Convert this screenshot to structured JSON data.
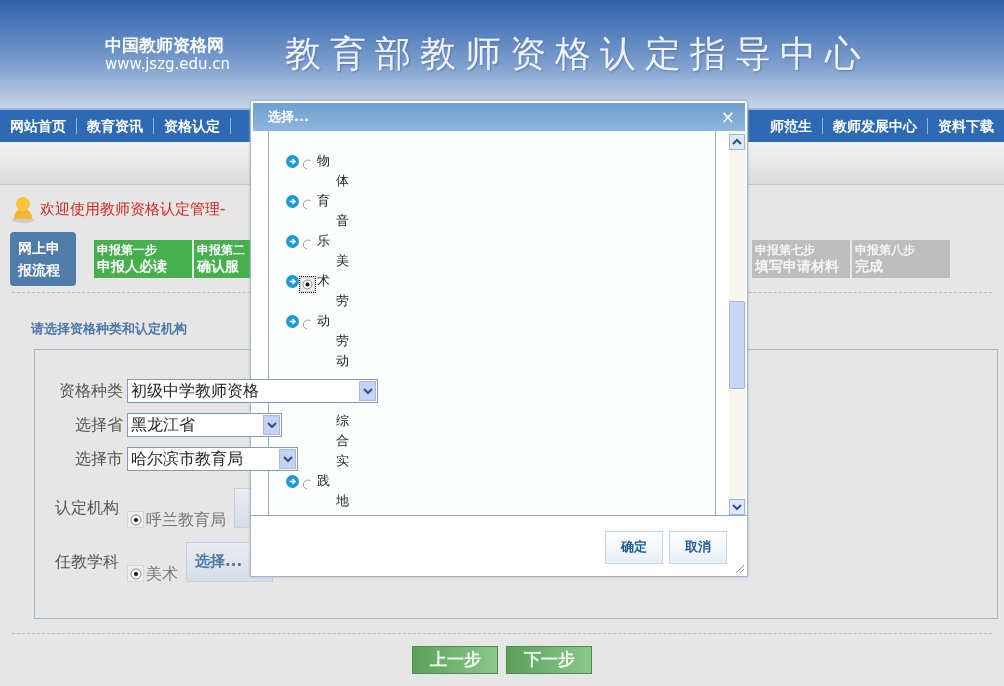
{
  "header": {
    "site_name": "中国教师资格网",
    "site_url": "www.jszg.edu.cn",
    "title": "教育部教师资格认定指导中心"
  },
  "nav": {
    "left": [
      "网站首页",
      "教育资讯",
      "资格认定"
    ],
    "right": [
      "师范生",
      "教师发展中心",
      "资料下载"
    ]
  },
  "welcome": "欢迎使用教师资格认定管理-",
  "process": {
    "label": "网上申报流程",
    "steps_left": [
      {
        "line1": "申报第一步",
        "line2": "申报人必读",
        "done": true
      },
      {
        "line1": "申报第二",
        "line2": "确认服",
        "done": true
      }
    ],
    "steps_right": [
      {
        "line1": "申报第七步",
        "line2": "填写申请材料",
        "done": false
      },
      {
        "line1": "申报第八步",
        "line2": "完成",
        "done": false
      }
    ]
  },
  "form": {
    "section_title": "请选择资格种类和认定机构",
    "selects": [
      {
        "label": "资格种类",
        "value": "初级中学教师资格"
      },
      {
        "label": "选择省",
        "value": "黑龙江省"
      },
      {
        "label": "选择市",
        "value": "哈尔滨市教育局"
      }
    ],
    "authority": {
      "label": "认定机构",
      "option": {
        "text": "呼兰教育局",
        "selected": true
      }
    },
    "subject": {
      "label": "任教学科",
      "option": {
        "text": "美术",
        "selected": true
      },
      "button": "选择..."
    }
  },
  "footer_buttons": [
    "上一步",
    "下一步"
  ],
  "dialog": {
    "title": "选择...",
    "close": "×",
    "lines": [
      {
        "kind": "option",
        "text": "物",
        "selected": false
      },
      {
        "kind": "text",
        "text": "体"
      },
      {
        "kind": "option",
        "text": "育",
        "selected": false
      },
      {
        "kind": "text",
        "text": "音"
      },
      {
        "kind": "option",
        "text": "乐",
        "selected": false
      },
      {
        "kind": "text",
        "text": "美"
      },
      {
        "kind": "option",
        "text": "术",
        "selected": true
      },
      {
        "kind": "text",
        "text": "劳"
      },
      {
        "kind": "option",
        "text": "动",
        "selected": false
      },
      {
        "kind": "text",
        "text": "劳"
      },
      {
        "kind": "text",
        "text": "动"
      },
      {
        "kind": "gap"
      },
      {
        "kind": "gap"
      },
      {
        "kind": "text",
        "text": "综"
      },
      {
        "kind": "text",
        "text": "合"
      },
      {
        "kind": "text",
        "text": "实"
      },
      {
        "kind": "option",
        "text": "践",
        "selected": false
      },
      {
        "kind": "text",
        "text": "地"
      }
    ],
    "buttons": [
      "确定",
      "取消"
    ]
  }
}
